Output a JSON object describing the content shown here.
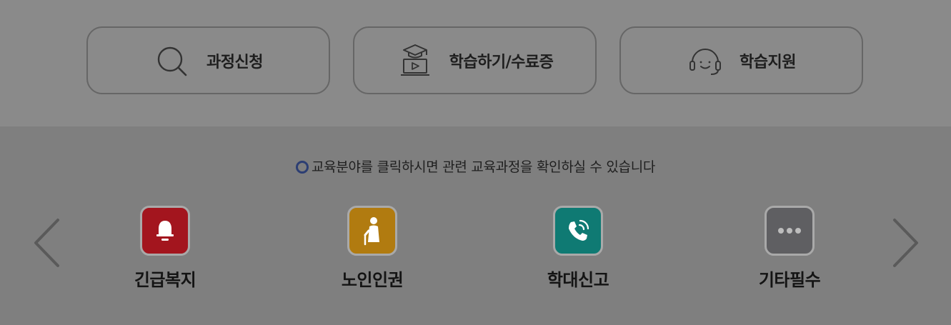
{
  "quick_menu": [
    {
      "label": "과정신청",
      "icon": "search-icon"
    },
    {
      "label": "학습하기/수료증",
      "icon": "graduation-video-icon"
    },
    {
      "label": "학습지원",
      "icon": "headset-icon"
    }
  ],
  "notice": {
    "text": "교육분야를 클릭하시면 관련 교육과정을 확인하실 수 있습니다"
  },
  "categories": [
    {
      "label": "긴급복지",
      "icon": "bell-icon",
      "color": "#a3151e"
    },
    {
      "label": "노인인권",
      "icon": "elderly-person-icon",
      "color": "#b17b10"
    },
    {
      "label": "학대신고",
      "icon": "phone-call-icon",
      "color": "#0f7a73"
    },
    {
      "label": "기타필수",
      "icon": "more-dots-icon",
      "color": "#5f5f62"
    }
  ],
  "colors": {
    "top_background": "#8a8a8a",
    "bottom_background": "#7f7f7f",
    "notice_ring": "#2c3e73"
  }
}
